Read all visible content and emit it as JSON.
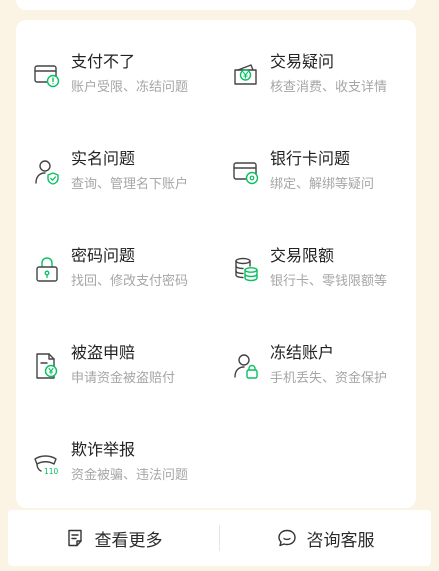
{
  "categories": [
    {
      "title": "支付不了",
      "subtitle": "账户受限、冻结问题",
      "icon": "card-blocked-icon"
    },
    {
      "title": "交易疑问",
      "subtitle": "核查消费、收支详情",
      "icon": "wallet-yen-icon"
    },
    {
      "title": "实名问题",
      "subtitle": "查询、管理名下账户",
      "icon": "user-shield-icon"
    },
    {
      "title": "银行卡问题",
      "subtitle": "绑定、解绑等疑问",
      "icon": "bank-card-gear-icon"
    },
    {
      "title": "密码问题",
      "subtitle": "找回、修改支付密码",
      "icon": "lock-icon"
    },
    {
      "title": "交易限额",
      "subtitle": "银行卡、零钱限额等",
      "icon": "coin-stack-icon"
    },
    {
      "title": "被盗申赔",
      "subtitle": "申请资金被盗赔付",
      "icon": "document-yen-icon"
    },
    {
      "title": "冻结账户",
      "subtitle": "手机丢失、资金保护",
      "icon": "user-lock-icon"
    },
    {
      "title": "欺诈举报",
      "subtitle": "资金被骗、违法问题",
      "icon": "megaphone-110-icon"
    }
  ],
  "footer": {
    "more_label": "查看更多",
    "more_icon": "document-icon",
    "service_label": "咨询客服",
    "service_icon": "chat-bubble-icon"
  },
  "colors": {
    "icon_gray": "#444444",
    "icon_accent": "#07c160",
    "background": "#fbf3e3"
  }
}
